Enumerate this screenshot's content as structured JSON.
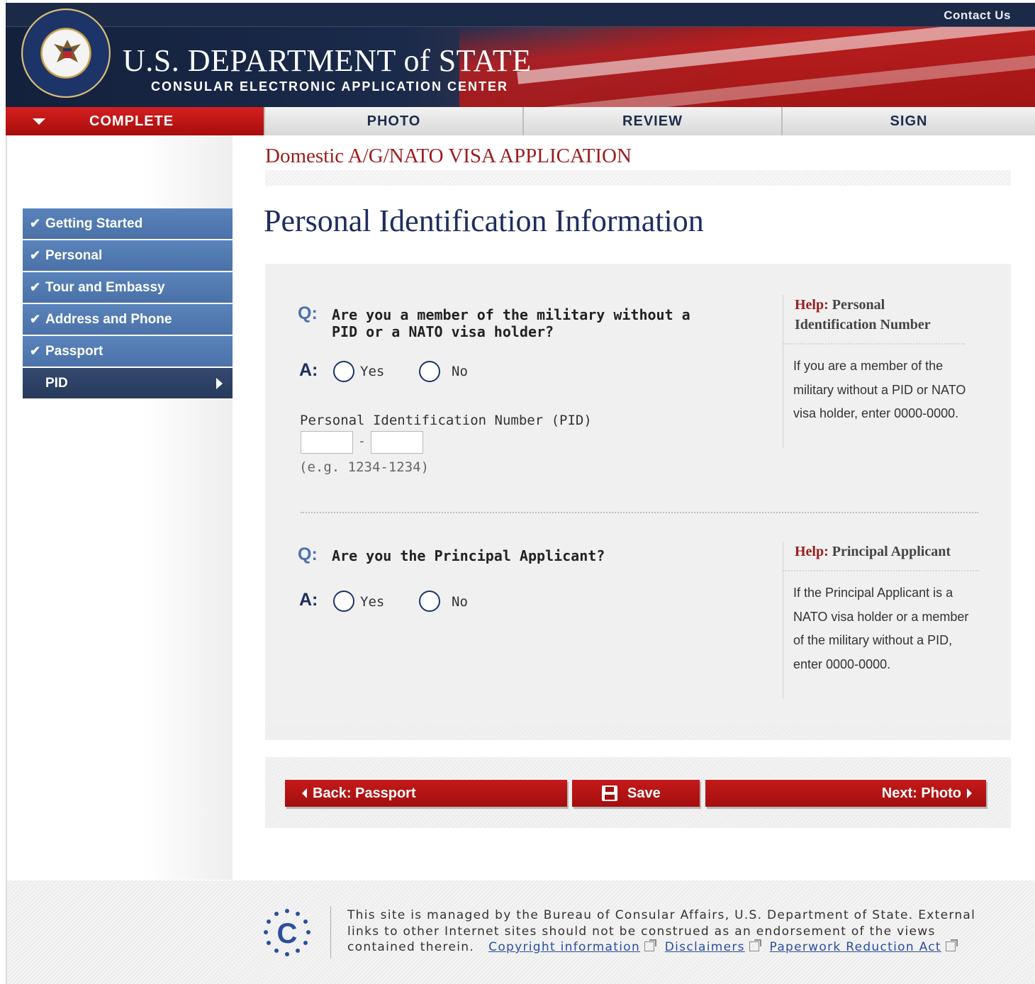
{
  "header": {
    "contact_link": "Contact Us",
    "dept_title": "U.S. DEPARTMENT of STATE",
    "dept_subtitle": "CONSULAR ELECTRONIC APPLICATION CENTER",
    "seal_icon": "state-department-seal-icon"
  },
  "steps": [
    {
      "label": "COMPLETE",
      "active": true
    },
    {
      "label": "PHOTO",
      "active": false
    },
    {
      "label": "REVIEW",
      "active": false
    },
    {
      "label": "SIGN",
      "active": false
    }
  ],
  "sidebar": {
    "items": [
      {
        "label": "Getting Started",
        "done": true
      },
      {
        "label": "Personal",
        "done": true
      },
      {
        "label": "Tour and Embassy",
        "done": true
      },
      {
        "label": "Address and Phone",
        "done": true
      },
      {
        "label": "Passport",
        "done": true
      },
      {
        "label": "PID",
        "current": true
      }
    ]
  },
  "main": {
    "application_title": "Domestic A/G/NATO VISA APPLICATION",
    "page_title": "Personal Identification Information",
    "q_marker": "Q:",
    "a_marker": "A:",
    "question1": {
      "line1": "Are you a  member of the military without a",
      "line2": "PID or a NATO visa  holder?",
      "yes_label": "Yes",
      "no_label": "No",
      "pid_label": "Personal Identification Number (PID)",
      "pid_part1": "",
      "pid_part2": "",
      "pid_separator": "-",
      "pid_hint": "(e.g. 1234-1234)"
    },
    "help1": {
      "help_word": "Help:",
      "title": "Personal Identification Number",
      "text": "If you  are a member of the military without a PID or NATO visa holder, enter 0000-0000."
    },
    "question2": {
      "text": "Are you the  Principal Applicant?",
      "yes_label": "Yes",
      "no_label": "No"
    },
    "help2": {
      "help_word": "Help:",
      "title": "Principal Applicant",
      "text": "If the Principal Applicant is a NATO visa holder or a member of the military without a PID, enter 0000-0000."
    }
  },
  "buttons": {
    "back": "Back:  Passport",
    "save": "Save",
    "next": "Next: Photo"
  },
  "footer": {
    "text": "This site is managed by the Bureau of Consular Affairs, U.S. Department of State. External links to other Internet sites should not be construed as an endorsement  of the views contained therein.",
    "links": [
      "Copyright information",
      "Disclaimers",
      "Paperwork Reduction Act"
    ],
    "logo_icon": "ceac-c-logo-icon"
  },
  "colors": {
    "accent_red": "#a40e0e",
    "nav_blue": "#4a72a8",
    "nav_current": "#263a5c",
    "title_navy": "#1d2d5d",
    "app_title_red": "#9b1d1d"
  }
}
